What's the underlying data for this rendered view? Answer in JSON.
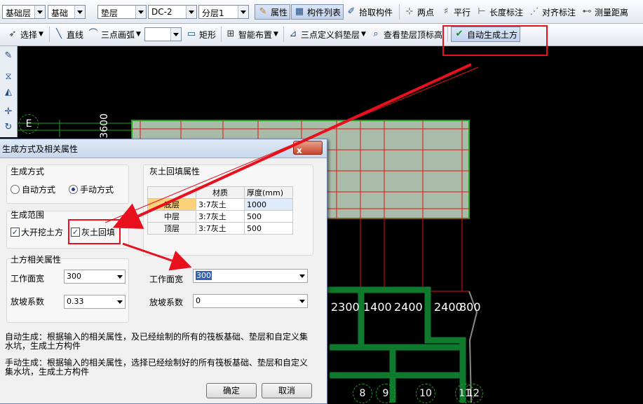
{
  "toolbar1": {
    "combo_layer": "基础层",
    "combo_category": "基础",
    "combo_type": "垫层",
    "combo_component": "DC-2",
    "combo_floor": "分层1",
    "btn_property": "属性",
    "btn_component_list": "构件列表",
    "btn_pick": "拾取构件",
    "btn_two_points": "两点",
    "btn_parallel": "平行",
    "btn_length_dim": "长度标注",
    "btn_align_dim": "对齐标注",
    "btn_measure": "测量距离"
  },
  "toolbar2": {
    "btn_select": "选择",
    "btn_line": "直线",
    "btn_arc": "三点画弧",
    "btn_rect": "矩形",
    "btn_smart": "智能布置",
    "btn_slope": "三点定义斜垫层",
    "btn_check_top": "查看垫层顶标高",
    "btn_auto_earth": "自动生成土方"
  },
  "canvas": {
    "left_dims": "3600",
    "axis_label_e": "E",
    "dim_row": [
      "2300",
      "1400",
      "2400",
      "2400",
      "800"
    ],
    "axis_numbers": [
      "8",
      "9",
      "10",
      "11",
      "12"
    ],
    "partial_num": "0"
  },
  "dialog": {
    "title": "生成方式及相关属性",
    "close_label": "x",
    "gen_mode": {
      "title": "生成方式",
      "auto_label": "自动方式",
      "manual_label": "手动方式",
      "selected": "manual"
    },
    "gen_range": {
      "title": "生成范围",
      "excavation_label": "大开挖土方",
      "backfill_label": "灰土回填",
      "excavation_checked": "✓",
      "backfill_checked": "✓"
    },
    "earth_props": {
      "title": "土方相关属性",
      "width_label": "工作面宽",
      "width_value": "300",
      "slope_label": "放坡系数",
      "slope_value": "0.33"
    },
    "backfill_props": {
      "title": "灰土回填属性",
      "col_material": "材质",
      "col_thickness": "厚度(mm)",
      "rows": [
        {
          "layer": "底层",
          "material": "3:7灰土",
          "thickness": "1000"
        },
        {
          "layer": "中层",
          "material": "3:7灰土",
          "thickness": "500"
        },
        {
          "layer": "顶层",
          "material": "3:7灰土",
          "thickness": "500"
        }
      ],
      "width_label": "工作面宽",
      "width_value": "300",
      "slope_label": "放坡系数",
      "slope_value": "0"
    },
    "desc_auto": "自动生成：根据输入的相关属性，及已经绘制的所有的筏板基础、垫层和自定义集水坑，生成土方构件",
    "desc_manual": "手动生成：根据输入的相关属性，选择已经绘制好的所有筏板基础、垫层和自定义集水坑，生成土方构件",
    "ok_label": "确定",
    "cancel_label": "取消"
  },
  "colors": {
    "highlight": "#e8101c",
    "arrow": "#e8101c",
    "slab_fill": "#a9bba9",
    "grid_line": "#e01414",
    "wall": "#0f7a2e"
  }
}
